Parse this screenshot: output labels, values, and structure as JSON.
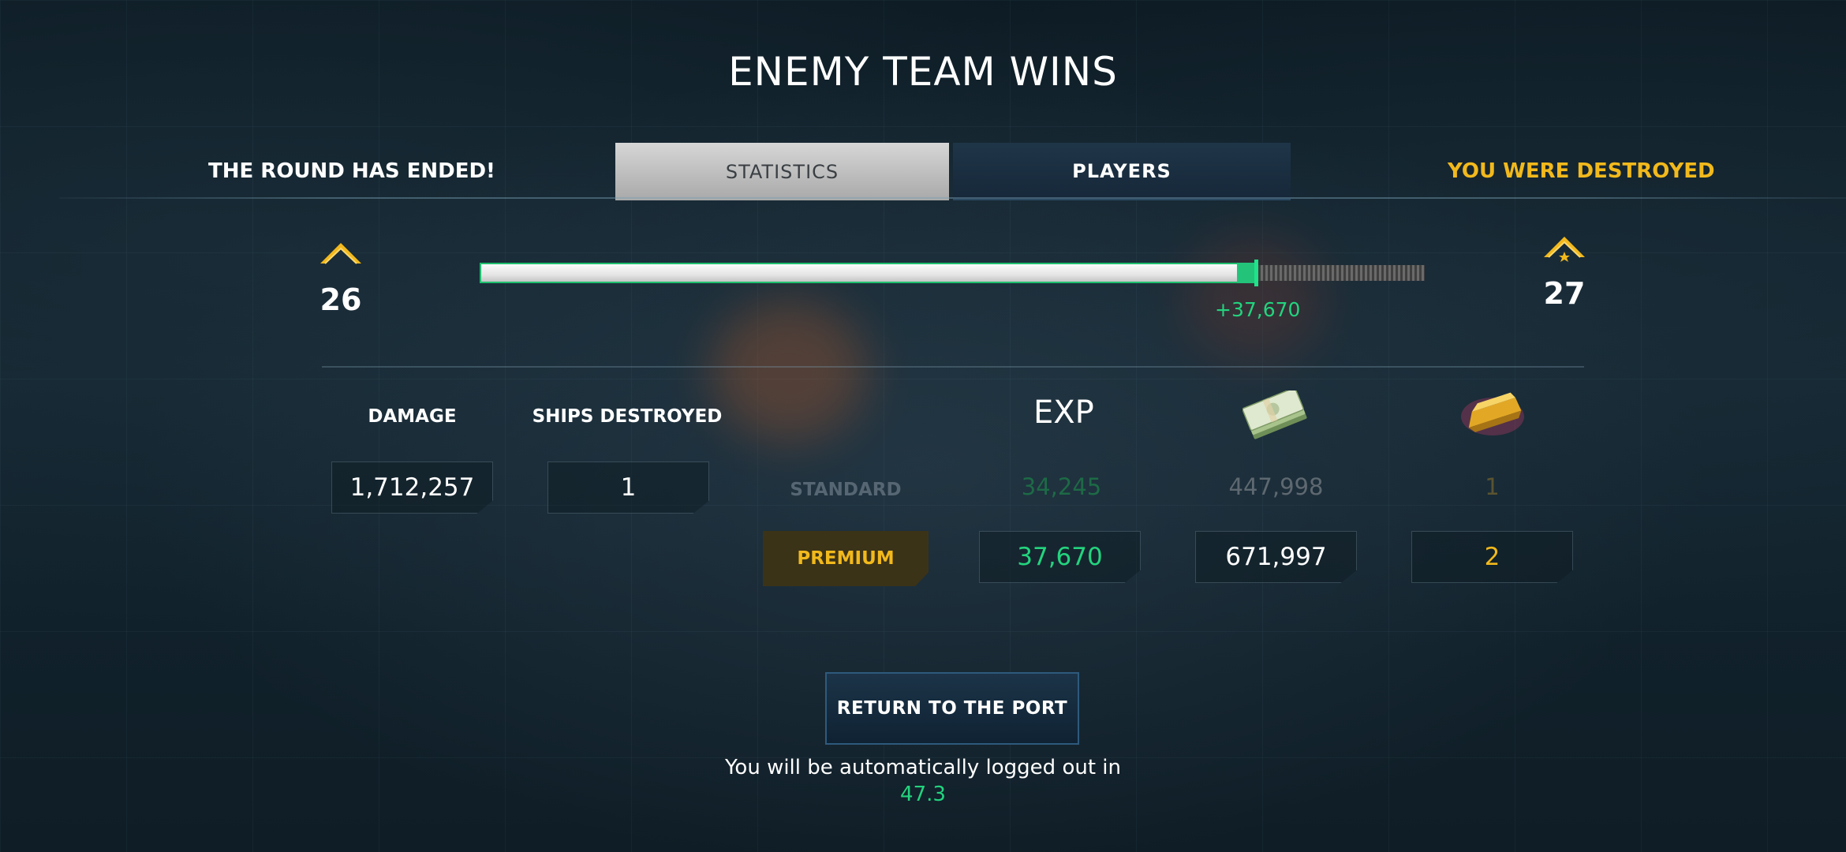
{
  "title": "ENEMY TEAM WINS",
  "status_left": "THE ROUND HAS ENDED!",
  "status_right": "YOU WERE DESTROYED",
  "tabs": [
    {
      "label": "STATISTICS",
      "active": true
    },
    {
      "label": "PLAYERS",
      "active": false
    }
  ],
  "progress": {
    "current_rank": "26",
    "next_rank": "27",
    "exp_gain_label": "+37,670",
    "fill_fraction": 0.82
  },
  "stats": {
    "damage_label": "DAMAGE",
    "damage_value": "1,712,257",
    "ships_label": "SHIPS DESTROYED",
    "ships_value": "1"
  },
  "rewards": {
    "exp_header": "EXP",
    "currency_icon": "cash-stack-icon",
    "gold_icon": "gold-bar-icon",
    "standard": {
      "label": "STANDARD",
      "exp": "34,245",
      "credits": "447,998",
      "gold": "1"
    },
    "premium": {
      "label": "PREMIUM",
      "exp": "37,670",
      "credits": "671,997",
      "gold": "2"
    }
  },
  "return_button": "RETURN TO THE PORT",
  "logout_text": "You will be automatically logged out in",
  "countdown": "47.3",
  "colors": {
    "accent_green": "#23d47e",
    "accent_gold": "#f2b91c",
    "background": "#132530"
  }
}
